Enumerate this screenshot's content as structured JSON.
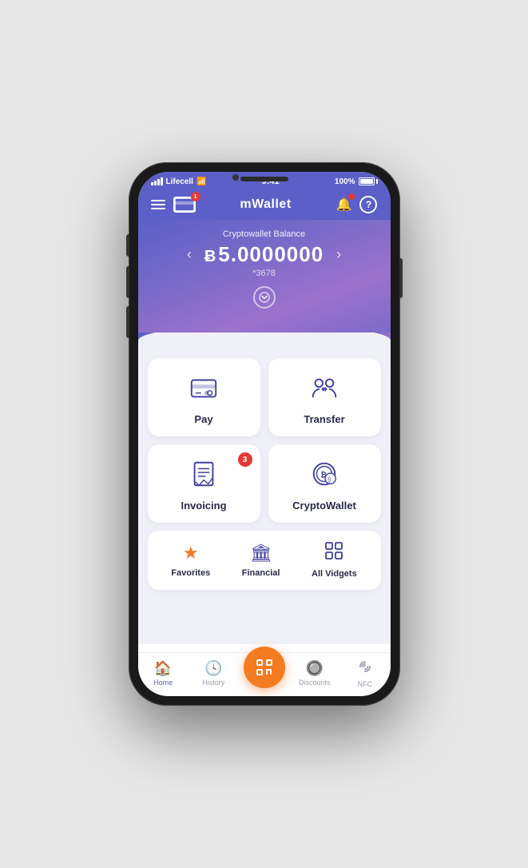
{
  "status_bar": {
    "carrier": "Lifecell",
    "time": "9:41",
    "battery": "100%"
  },
  "header": {
    "title": "mWallet",
    "card_badge": "1"
  },
  "balance": {
    "label": "Cryptowallet Balance",
    "currency_symbol": "Ƀ",
    "amount": "5.0000000",
    "account": "*3678"
  },
  "actions": [
    {
      "id": "pay",
      "label": "Pay",
      "badge": null
    },
    {
      "id": "transfer",
      "label": "Transfer",
      "badge": null
    },
    {
      "id": "invoicing",
      "label": "Invoicing",
      "badge": "3"
    },
    {
      "id": "cryptowallet",
      "label": "CryptoWallet",
      "badge": null
    }
  ],
  "widgets": [
    {
      "id": "favorites",
      "label": "Favorites"
    },
    {
      "id": "financial",
      "label": "Financial"
    },
    {
      "id": "all-vidgets",
      "label": "All Vidgets"
    }
  ],
  "bottom_nav": [
    {
      "id": "home",
      "label": "Home",
      "active": true
    },
    {
      "id": "history",
      "label": "History",
      "active": false
    },
    {
      "id": "scan",
      "label": "",
      "active": false,
      "center": true
    },
    {
      "id": "discounts",
      "label": "Discounts",
      "active": false
    },
    {
      "id": "nfc",
      "label": "NFC",
      "active": false
    }
  ]
}
